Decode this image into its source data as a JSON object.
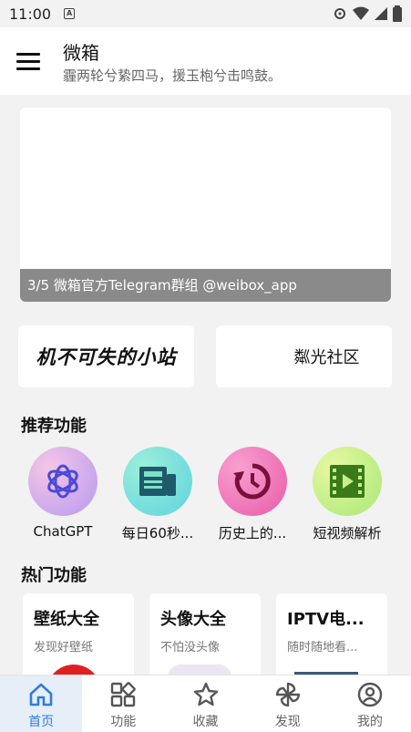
{
  "status": {
    "time": "11:00"
  },
  "app": {
    "title": "微箱",
    "subtitle": "霾两轮兮絷四马，援玉枹兮击鸣鼓。"
  },
  "banner": {
    "caption": "3/5 微箱官方Telegram群组 @weibox_app"
  },
  "cards": {
    "left": "机不可失的小站",
    "right": "粼光社区"
  },
  "recommended": {
    "title": "推荐功能",
    "items": [
      {
        "label": "ChatGPT",
        "icon": "openai-icon",
        "color": "#d9a8f0"
      },
      {
        "label": "每日60秒...",
        "icon": "news-icon",
        "color": "#7fe0c8"
      },
      {
        "label": "历史上的...",
        "icon": "history-icon",
        "color": "#f07ab8"
      },
      {
        "label": "短视频解析",
        "icon": "video-icon",
        "color": "#c8f088"
      }
    ]
  },
  "hot": {
    "title": "热门功能",
    "items": [
      {
        "title": "壁纸大全",
        "subtitle": "发现好壁纸"
      },
      {
        "title": "头像大全",
        "subtitle": "不怕没头像"
      },
      {
        "title": "IPTV电...",
        "subtitle": "随时随地看..."
      }
    ]
  },
  "nav": {
    "items": [
      {
        "label": "首页",
        "icon": "home-icon"
      },
      {
        "label": "功能",
        "icon": "grid-icon"
      },
      {
        "label": "收藏",
        "icon": "star-icon"
      },
      {
        "label": "发现",
        "icon": "pinwheel-icon"
      },
      {
        "label": "我的",
        "icon": "person-icon"
      }
    ]
  }
}
